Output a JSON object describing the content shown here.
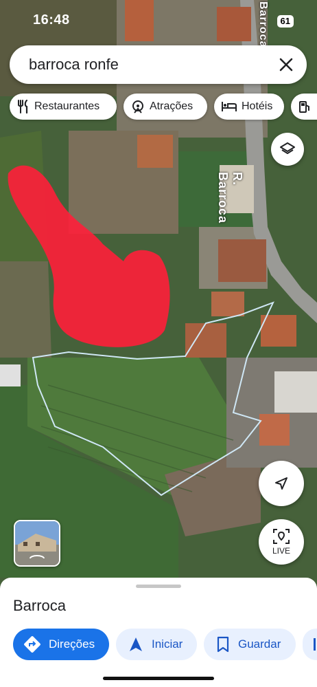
{
  "status": {
    "time": "16:48",
    "battery": "61"
  },
  "search": {
    "query": "barroca ronfe"
  },
  "chips": [
    {
      "label": "Restaurantes",
      "icon": "fork-knife-icon"
    },
    {
      "label": "Atrações",
      "icon": "attractions-icon"
    },
    {
      "label": "Hotéis",
      "icon": "bed-icon"
    },
    {
      "label": "",
      "icon": "gas-station-icon"
    }
  ],
  "map": {
    "street_label_main": "R. Barroca",
    "street_label_top": "Barroca"
  },
  "buttons": {
    "live_label": "LIVE"
  },
  "place": {
    "title": "Barroca"
  },
  "actions": [
    {
      "label": "Direções",
      "icon": "directions-icon"
    },
    {
      "label": "Iniciar",
      "icon": "navigation-arrow-icon"
    },
    {
      "label": "Guardar",
      "icon": "bookmark-icon"
    }
  ],
  "colors": {
    "accent": "#1a73e8",
    "accent_light": "#e8f0fe",
    "highlight": "#ff1f3a"
  }
}
